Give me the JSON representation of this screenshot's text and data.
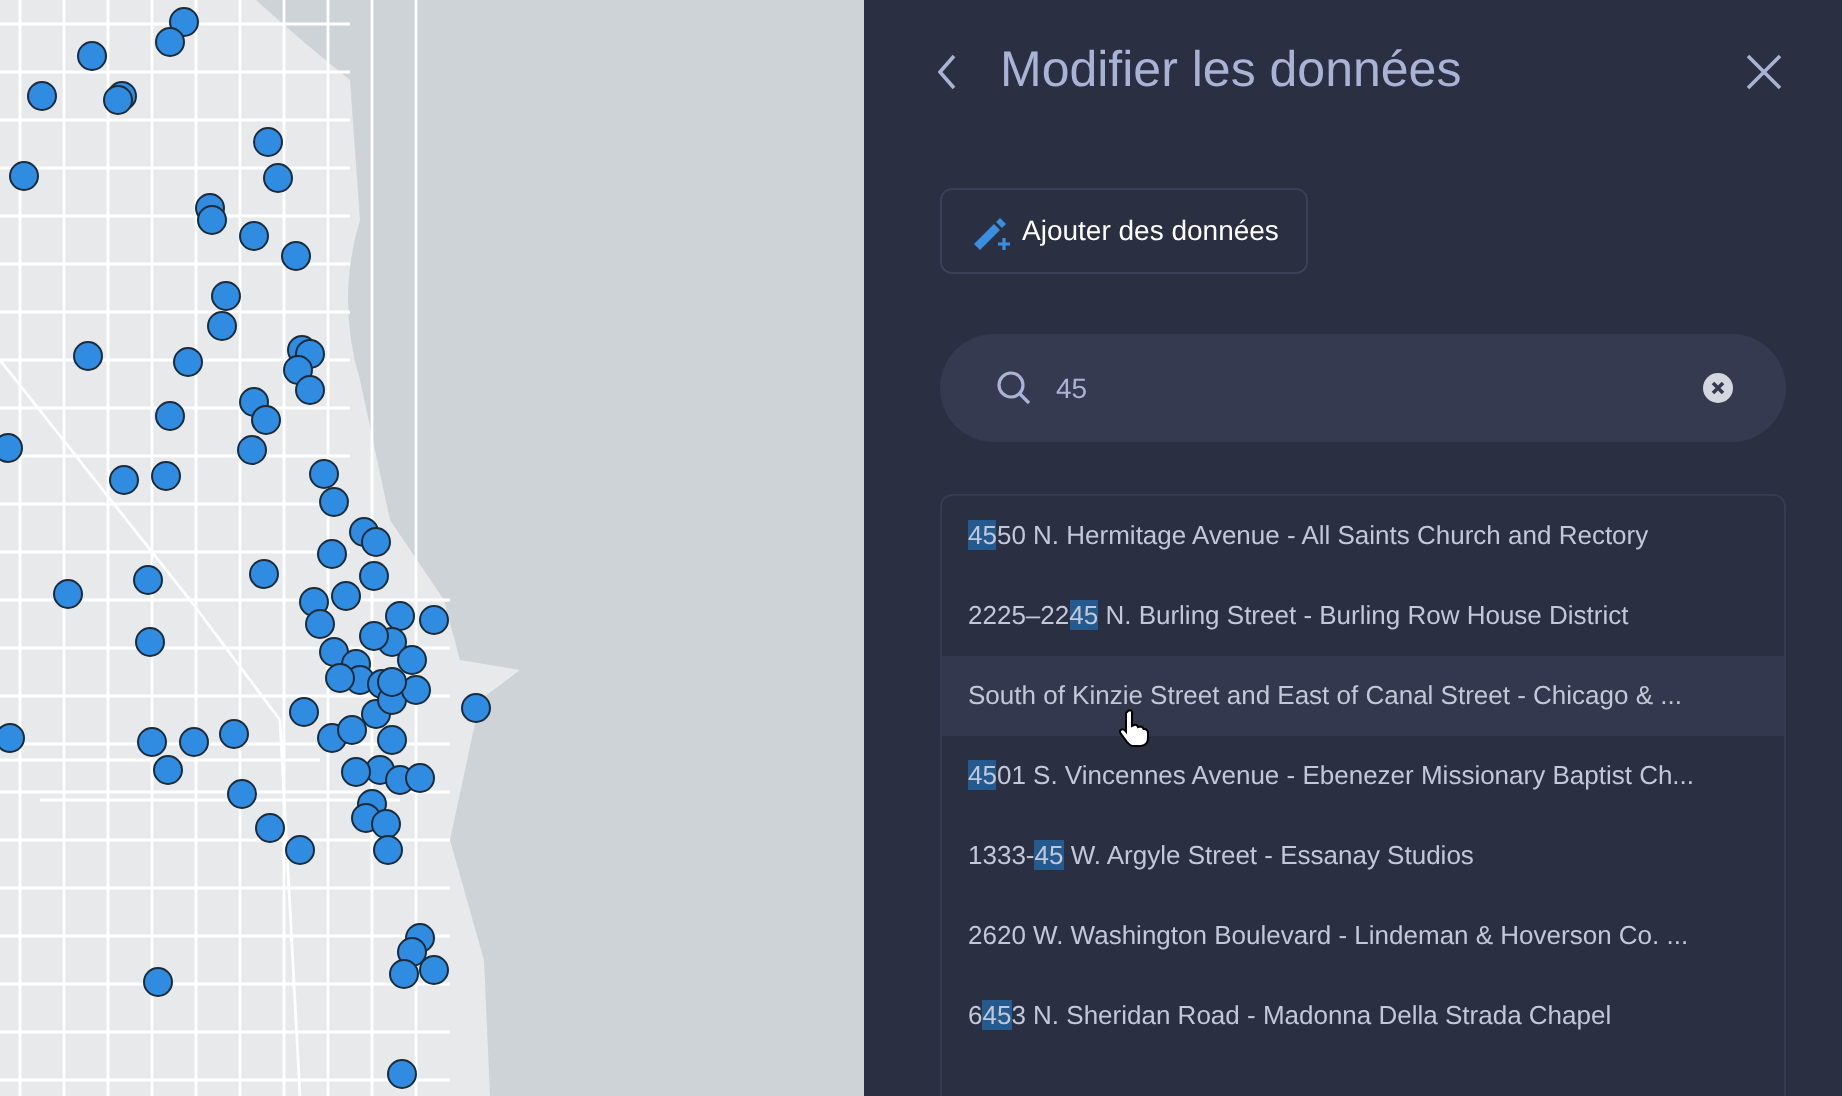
{
  "panel": {
    "title": "Modifier les données",
    "add_button": {
      "label": "Ajouter des données"
    },
    "search": {
      "value": "45"
    },
    "results": [
      {
        "hovered": false,
        "segments": [
          {
            "text": "45",
            "highlighted": true
          },
          {
            "text": "50 N. Hermitage Avenue - All Saints Church and Rectory",
            "highlighted": false
          }
        ]
      },
      {
        "hovered": false,
        "segments": [
          {
            "text": "2225–22",
            "highlighted": false
          },
          {
            "text": "45",
            "highlighted": true
          },
          {
            "text": " N. Burling Street - Burling Row House District",
            "highlighted": false
          }
        ]
      },
      {
        "hovered": true,
        "segments": [
          {
            "text": "South of Kinzie Street and East of Canal Street - Chicago & ...",
            "highlighted": false
          }
        ]
      },
      {
        "hovered": false,
        "segments": [
          {
            "text": "45",
            "highlighted": true
          },
          {
            "text": "01 S. Vincennes Avenue - Ebenezer Missionary Baptist Ch...",
            "highlighted": false
          }
        ]
      },
      {
        "hovered": false,
        "segments": [
          {
            "text": "1333-",
            "highlighted": false
          },
          {
            "text": "45",
            "highlighted": true
          },
          {
            "text": " W. Argyle Street - Essanay Studios",
            "highlighted": false
          }
        ]
      },
      {
        "hovered": false,
        "segments": [
          {
            "text": "2620 W. Washington Boulevard - Lindeman & Hoverson Co. ...",
            "highlighted": false
          }
        ]
      },
      {
        "hovered": false,
        "segments": [
          {
            "text": "6",
            "highlighted": false
          },
          {
            "text": "45",
            "highlighted": true
          },
          {
            "text": "3 N. Sheridan Road - Madonna Della Strada Chapel",
            "highlighted": false
          }
        ]
      }
    ]
  }
}
